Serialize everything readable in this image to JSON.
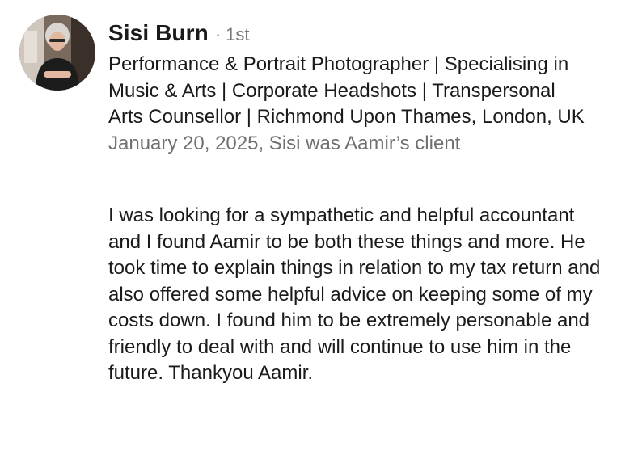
{
  "recommendation": {
    "author_name": "Sisi Burn",
    "separator": "·",
    "connection_degree": "1st",
    "headline": "Performance & Portrait Photographer | Specialising in Music & Arts | Corporate Headshots | Transpersonal Arts Counsellor | Richmond Upon Thames, London, UK",
    "meta": "January 20, 2025, Sisi was Aamir’s client",
    "text": "I was looking for a sympathetic and helpful accountant and I found Aamir to be both these things and more. He took time to explain things in relation to my tax return and also offered some helpful advice on keeping some of my costs down. I found him to be extremely personable and friendly to deal with and will continue to use him in the future. Thankyou Aamir."
  },
  "icons": {
    "avatar": "profile-photo"
  }
}
